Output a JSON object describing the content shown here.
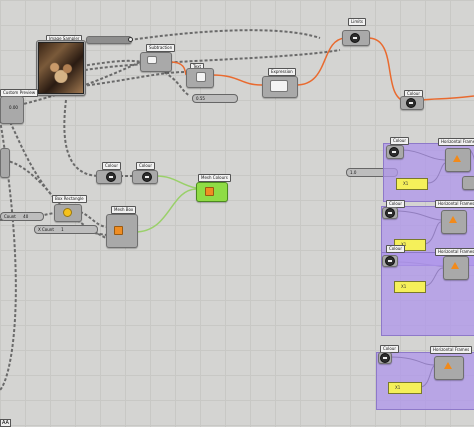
{
  "canvas": {
    "title_image_sampler": "Image Sampler",
    "subtraction": "Subtraction",
    "vertex_text": "Text",
    "expression": "Expression",
    "limits": "Limits",
    "color": "Colour",
    "colour2": "Colour",
    "mesh_colours": "Mesh Colours",
    "box_rectangle": "Box Rectangle",
    "mesh_box": "Mesh Box",
    "left_panel": "Custom Preview",
    "left_panel_val": "0.00",
    "num_slider_val": "0.55",
    "xcount_label": "X Count",
    "xcount_val": "1",
    "count_label": "Count",
    "count_val": "40",
    "left_val": "1.0",
    "bottom_tag": "AA",
    "groups": [
      {
        "top_label": "Colour",
        "right_label": "Horizontal Frames",
        "yellow": "X1"
      },
      {
        "top_label": "Colour",
        "right_label": "Horizontal Frames",
        "yellow": "X1"
      },
      {
        "top_label": "Colour",
        "right_label": "Horizontal Frames",
        "yellow": "X1"
      },
      {
        "top_label": "Colour",
        "right_label": "Horizontal Frames",
        "yellow": "X1"
      }
    ]
  },
  "colors": {
    "canvas_bg": "#d4d4d2",
    "wire_orange": "#e96a2f",
    "wire_gray": "#6a6a6a",
    "wire_green": "#9ad06a",
    "group_fill": "#af96eb",
    "panel_yellow": "#f5f05a",
    "node_green": "#8fdc45"
  }
}
